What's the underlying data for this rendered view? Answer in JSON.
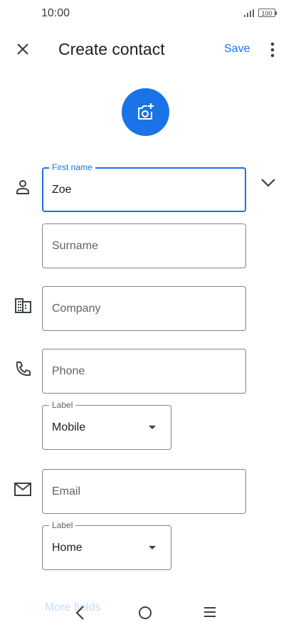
{
  "status": {
    "time": "10:00",
    "battery": "100"
  },
  "header": {
    "title": "Create contact",
    "save_label": "Save"
  },
  "form": {
    "first_name": {
      "label": "First name",
      "value": "Zoe"
    },
    "surname": {
      "placeholder": "Surname"
    },
    "company": {
      "placeholder": "Company"
    },
    "phone": {
      "placeholder": "Phone"
    },
    "phone_label": {
      "label": "Label",
      "value": "Mobile"
    },
    "email": {
      "placeholder": "Email"
    },
    "email_label": {
      "label": "Label",
      "value": "Home"
    },
    "more_fields": "More fields"
  },
  "icons": {
    "close": "close-icon",
    "more": "more-vert-icon",
    "photo": "add-photo-icon",
    "person": "person-icon",
    "company": "business-icon",
    "phone": "phone-icon",
    "email": "mail-icon",
    "expand": "chevron-down-icon"
  },
  "colors": {
    "accent": "#1a73e8",
    "text": "#202124",
    "muted": "#5f6368"
  }
}
